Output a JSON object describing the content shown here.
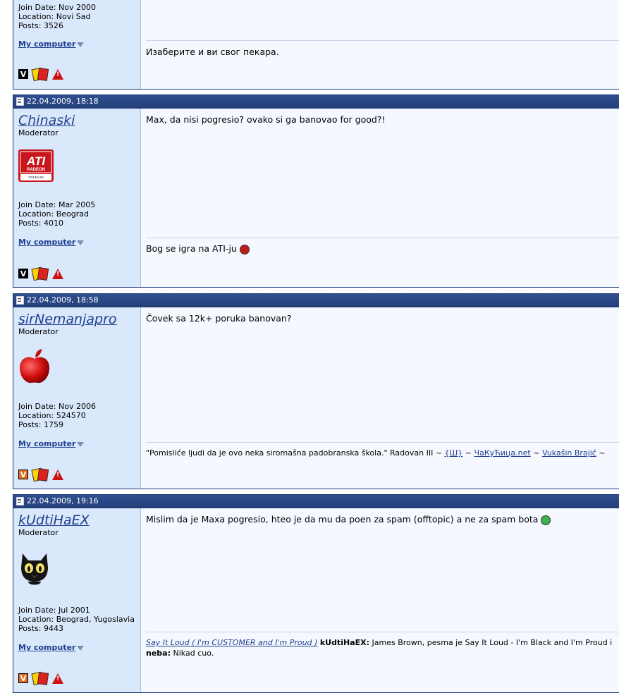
{
  "posts": [
    {
      "join_date": "Join Date: Nov 2000",
      "location": "Location: Novi Sad",
      "posts": "Posts: 3526",
      "my_computer": "My computer",
      "signature": "Изаберите и ви свог пекара."
    },
    {
      "date": "22.04.2009, 18:18",
      "username": "Chinaski",
      "title": "Moderator",
      "avatar": "ati-radeon-logo",
      "join_date": "Join Date: Mar 2005",
      "location": "Location: Beograd",
      "posts": "Posts: 4010",
      "my_computer": "My computer",
      "message": "Max, da nisi pogresio? ovako si ga banovao for good?!",
      "signature": "Bog se igra na ATI-ju"
    },
    {
      "date": "22.04.2009, 18:58",
      "username": "sirNemanjapro",
      "title": "Moderator",
      "avatar": "apple-logo",
      "join_date": "Join Date: Nov 2006",
      "location": "Location: 524570",
      "posts": "Posts: 1759",
      "my_computer": "My computer",
      "message": "Čovek sa 12k+ poruka banovan?",
      "signature_text": "\"Pomisliće ljudi da je ovo neka siromašna padobranska škola.\" Radovan III ~ ",
      "sig_link1": "{Ш}",
      "sig_sep1": " ~ ",
      "sig_link2": "ЧаКуЋица.net",
      "sig_sep2": " ~ ",
      "sig_link3": "Vukašin Brajić",
      "sig_tail": " ~"
    },
    {
      "date": "22.04.2009, 19:16",
      "username": "kUdtiHaEX",
      "title": "Moderator",
      "avatar": "black-cat",
      "join_date": "Join Date: Jul 2001",
      "location": "Location: Beograd, Yugoslavia",
      "posts": "Posts: 9443",
      "my_computer": "My computer",
      "message": "Mislim da je Maxa pogresio, hteo je da mu da poen za spam (offtopic) a ne za spam bota",
      "sig_link": "Say It Loud ( I'm CUSTOMER and I'm Proud )",
      "sig_name1": "kUdtiHaEX:",
      "sig_text1": " James Brown, pesma je Say It Loud - I'm Black and I'm Proud i",
      "sig_name2": "neba:",
      "sig_text2": " Nikad cuo."
    }
  ],
  "icons": {
    "v_label": "V"
  }
}
